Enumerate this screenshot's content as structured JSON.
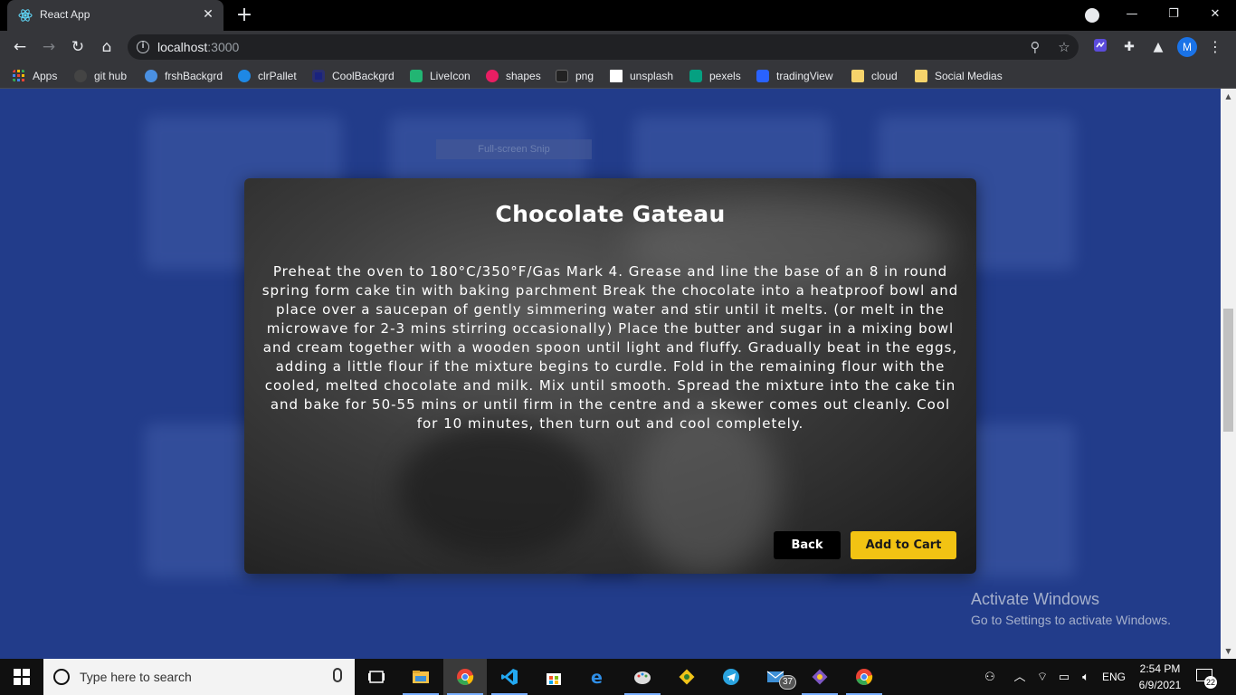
{
  "browser": {
    "tab_title": "React App",
    "url_host": "localhost",
    "url_port": ":3000",
    "profile_initial": "M"
  },
  "bookmarks": [
    {
      "label": "Apps",
      "icon": "apps-grid-icon",
      "color": "#e94235"
    },
    {
      "label": "git hub",
      "icon": "github-icon",
      "color": "#333333"
    },
    {
      "label": "frshBackgrd",
      "icon": "frshbackgrd-icon",
      "color": "#4a90e2"
    },
    {
      "label": "clrPallet",
      "icon": "clrpallet-icon",
      "color": "#1e88e5"
    },
    {
      "label": "CoolBackgrd",
      "icon": "coolbackgrd-icon",
      "color": "#1a237e"
    },
    {
      "label": "LiveIcon",
      "icon": "liveicon-icon",
      "color": "#22b573"
    },
    {
      "label": "shapes",
      "icon": "shapes-icon",
      "color": "#e91e63"
    },
    {
      "label": "png",
      "icon": "png-icon",
      "color": "#222222"
    },
    {
      "label": "unsplash",
      "icon": "unsplash-icon",
      "color": "#ffffff"
    },
    {
      "label": "pexels",
      "icon": "pexels-icon",
      "color": "#05a081"
    },
    {
      "label": "tradingView",
      "icon": "tradingview-icon",
      "color": "#2962ff"
    },
    {
      "label": "cloud",
      "icon": "folder-icon",
      "color": "#f6d36b"
    },
    {
      "label": "Social Medias",
      "icon": "folder-icon",
      "color": "#f6d36b"
    }
  ],
  "page": {
    "overlay_text": "Full-screen Snip",
    "modal": {
      "title": "Chocolate Gateau",
      "description": "Preheat the oven to 180°C/350°F/Gas Mark 4. Grease and line the base of an 8 in round spring form cake tin with baking parchment Break the chocolate into a heatproof bowl and place over a saucepan of gently simmering water and stir until it melts. (or melt in the microwave for 2-3 mins stirring occasionally) Place the butter and sugar in a mixing bowl and cream together with a wooden spoon until light and fluffy. Gradually beat in the eggs, adding a little flour if the mixture begins to curdle. Fold in the remaining flour with the cooled, melted chocolate and milk. Mix until smooth. Spread the mixture into the cake tin and bake for 50-55 mins or until firm in the centre and a skewer comes out cleanly. Cool for 10 minutes, then turn out and cool completely.",
      "back_label": "Back",
      "cart_label": "Add to Cart",
      "cart_color": "#f2c313"
    },
    "watermark": {
      "line1": "Activate Windows",
      "line2": "Go to Settings to activate Windows."
    }
  },
  "taskbar": {
    "search_placeholder": "Type here to search",
    "mail_badge": "37",
    "language": "ENG",
    "time": "2:54 PM",
    "date": "6/9/2021",
    "notification_count": "22"
  }
}
